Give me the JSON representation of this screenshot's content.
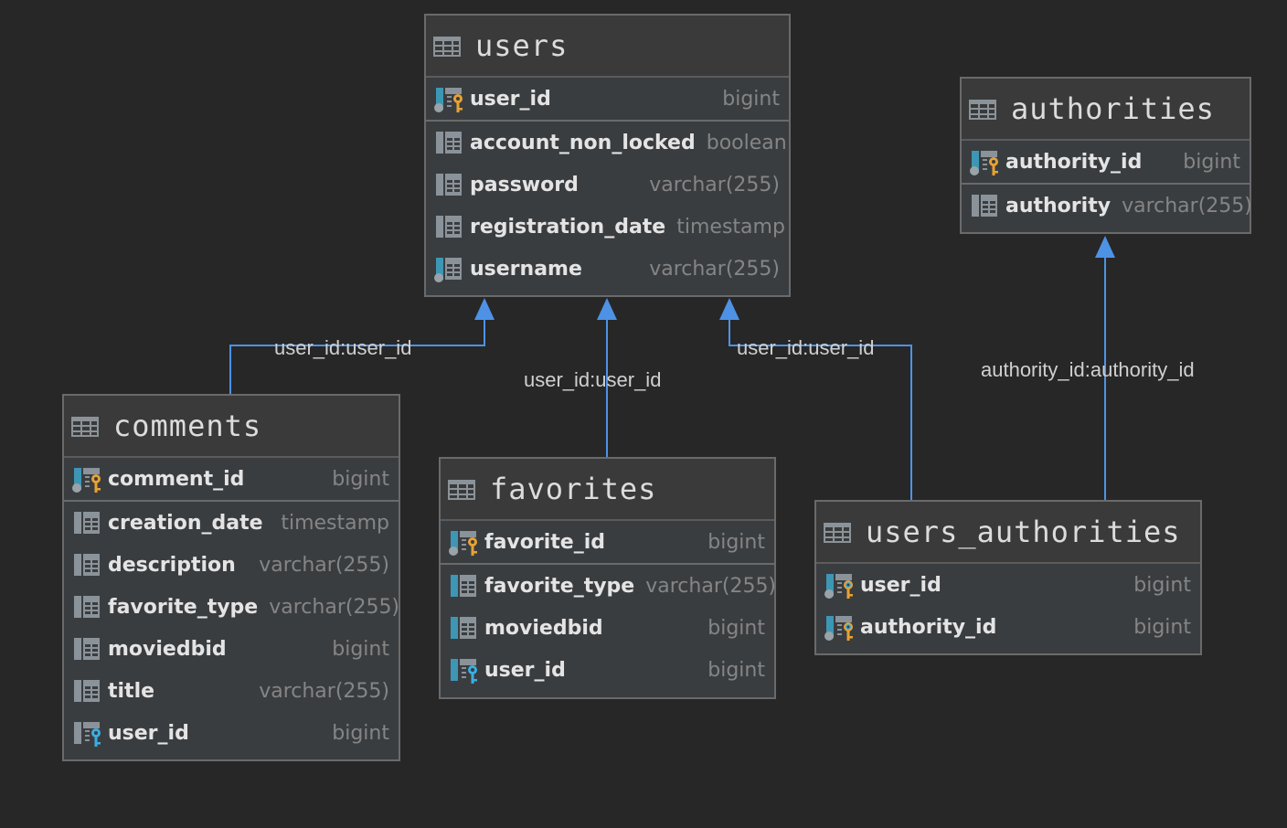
{
  "colors": {
    "background": "#272727",
    "table_body": "#3a3d40",
    "table_header": "#3a3a3a",
    "edge": "#4e92e6",
    "pk_key": "#e6a235",
    "fk_key": "#3aaee0",
    "column_accent": "#3d97b4",
    "column_text": "#e4e4e4",
    "type_text": "#858585"
  },
  "tables": {
    "users": {
      "name": "users",
      "pk": [
        {
          "name": "user_id",
          "type": "bigint",
          "icon": "primary-key-column-icon"
        }
      ],
      "columns": [
        {
          "name": "account_non_locked",
          "type": "boolean",
          "icon": "column-icon"
        },
        {
          "name": "password",
          "type": "varchar(255)",
          "icon": "column-icon"
        },
        {
          "name": "registration_date",
          "type": "timestamp",
          "icon": "column-icon"
        },
        {
          "name": "username",
          "type": "varchar(255)",
          "icon": "unique-not-null-column-icon"
        }
      ]
    },
    "authorities": {
      "name": "authorities",
      "pk": [
        {
          "name": "authority_id",
          "type": "bigint",
          "icon": "primary-key-column-icon"
        }
      ],
      "columns": [
        {
          "name": "authority",
          "type": "varchar(255)",
          "icon": "column-icon"
        }
      ]
    },
    "comments": {
      "name": "comments",
      "pk": [
        {
          "name": "comment_id",
          "type": "bigint",
          "icon": "primary-key-column-icon"
        }
      ],
      "columns": [
        {
          "name": "creation_date",
          "type": "timestamp",
          "icon": "column-icon"
        },
        {
          "name": "description",
          "type": "varchar(255)",
          "icon": "column-icon"
        },
        {
          "name": "favorite_type",
          "type": "varchar(255)",
          "icon": "column-icon"
        },
        {
          "name": "moviedbid",
          "type": "bigint",
          "icon": "column-icon"
        },
        {
          "name": "title",
          "type": "varchar(255)",
          "icon": "column-icon"
        },
        {
          "name": "user_id",
          "type": "bigint",
          "icon": "foreign-key-column-icon"
        }
      ]
    },
    "favorites": {
      "name": "favorites",
      "pk": [
        {
          "name": "favorite_id",
          "type": "bigint",
          "icon": "primary-key-column-icon"
        }
      ],
      "columns": [
        {
          "name": "favorite_type",
          "type": "varchar(255)",
          "icon": "not-null-column-icon"
        },
        {
          "name": "moviedbid",
          "type": "bigint",
          "icon": "not-null-column-icon"
        },
        {
          "name": "user_id",
          "type": "bigint",
          "icon": "foreign-key-not-null-column-icon"
        }
      ]
    },
    "users_authorities": {
      "name": "users_authorities",
      "pk": [
        {
          "name": "user_id",
          "type": "bigint",
          "icon": "primary-foreign-key-column-icon"
        },
        {
          "name": "authority_id",
          "type": "bigint",
          "icon": "primary-foreign-key-column-icon"
        }
      ],
      "columns": []
    }
  },
  "relations": [
    {
      "from": "comments",
      "to": "users",
      "label": "user_id:user_id"
    },
    {
      "from": "favorites",
      "to": "users",
      "label": "user_id:user_id"
    },
    {
      "from": "users_authorities",
      "to": "users",
      "label": "user_id:user_id"
    },
    {
      "from": "users_authorities",
      "to": "authorities",
      "label": "authority_id:authority_id"
    }
  ]
}
